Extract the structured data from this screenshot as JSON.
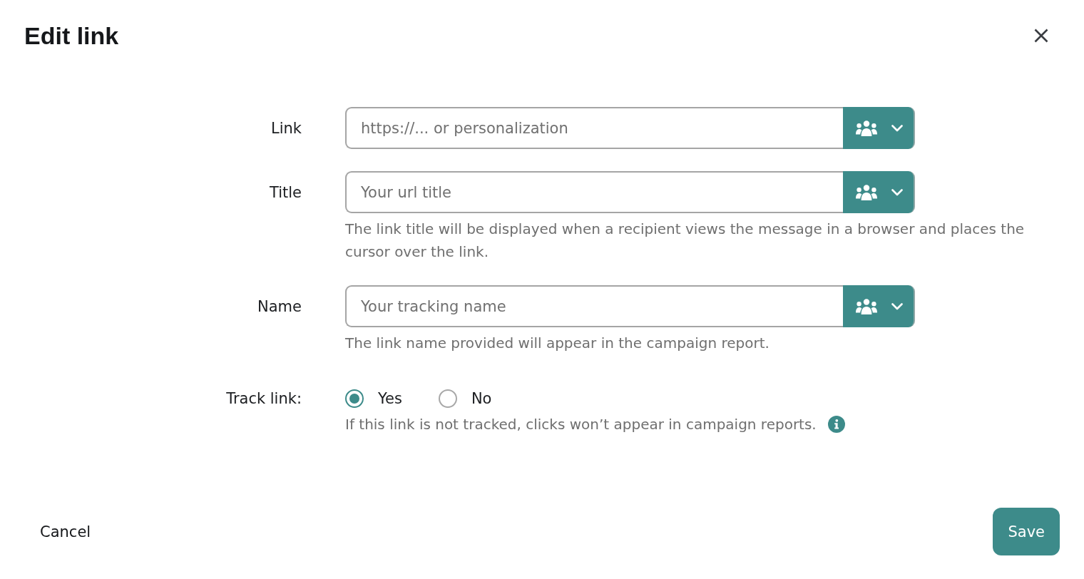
{
  "dialog": {
    "title": "Edit link"
  },
  "fields": [
    {
      "label": "Link",
      "placeholder": "https://... or personalization"
    },
    {
      "label": "Title",
      "placeholder": "Your url title",
      "help": "The link title will be displayed when a recipient views the message in a browser and places the cursor over the link."
    },
    {
      "label": "Name",
      "placeholder": "Your tracking name",
      "help": "The link name provided will appear in the campaign report."
    }
  ],
  "track_link": {
    "label": "Track link:",
    "options": [
      {
        "label": "Yes",
        "selected": true
      },
      {
        "label": "No",
        "selected": false
      }
    ],
    "help": "If this link is not tracked, clicks won’t appear in campaign reports."
  },
  "footer": {
    "cancel": "Cancel",
    "save": "Save"
  }
}
